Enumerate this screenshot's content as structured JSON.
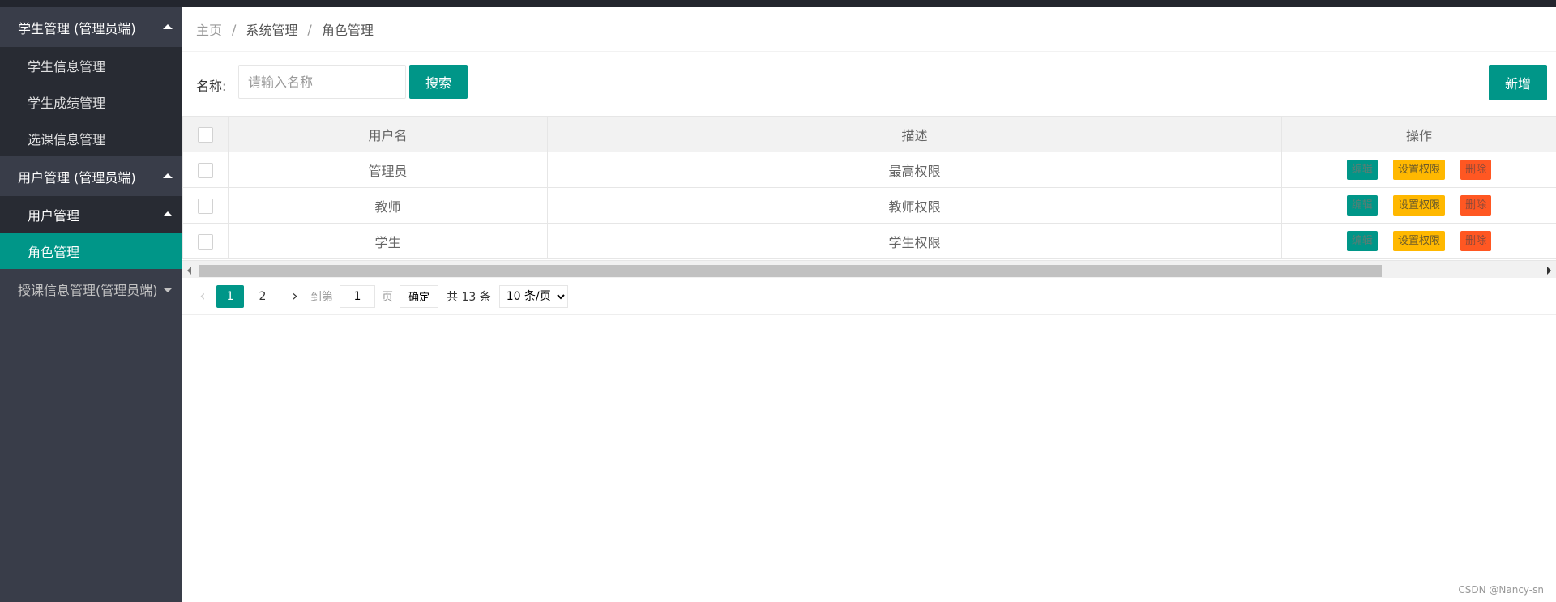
{
  "sidebar": {
    "group1": {
      "label": "学生管理 (管理员端)",
      "items": [
        "学生信息管理",
        "学生成绩管理",
        "选课信息管理"
      ]
    },
    "group2": {
      "label": "用户管理 (管理员端)",
      "sub_label": "用户管理",
      "active_item": "角色管理"
    },
    "group3": {
      "label": "授课信息管理(管理员端)"
    }
  },
  "breadcrumb": {
    "home": "主页",
    "sep": "/",
    "level2": "系统管理",
    "current": "角色管理"
  },
  "toolbar": {
    "name_label": "名称:",
    "search_placeholder": "请输入名称",
    "search_label": "搜索",
    "add_label": "新增"
  },
  "table": {
    "headers": [
      "用户名",
      "描述",
      "操作"
    ],
    "rows": [
      {
        "name": "管理员",
        "desc": "最高权限"
      },
      {
        "name": "教师",
        "desc": "教师权限"
      },
      {
        "name": "学生",
        "desc": "学生权限"
      }
    ],
    "ops": {
      "edit": "编辑",
      "perm": "设置权限",
      "del": "删除"
    }
  },
  "pager": {
    "prev": "‹",
    "next": "›",
    "pages": [
      "1",
      "2"
    ],
    "goto_label": "到第",
    "goto_value": "1",
    "page_unit": "页",
    "confirm_label": "确定",
    "total_label": "共 13 条",
    "page_size": "10 条/页"
  },
  "watermark": "CSDN @Nancy-sn",
  "colors": {
    "primary": "#009688",
    "warning": "#ffb800",
    "danger": "#ff5722",
    "sidebar_bg": "#393d49"
  }
}
